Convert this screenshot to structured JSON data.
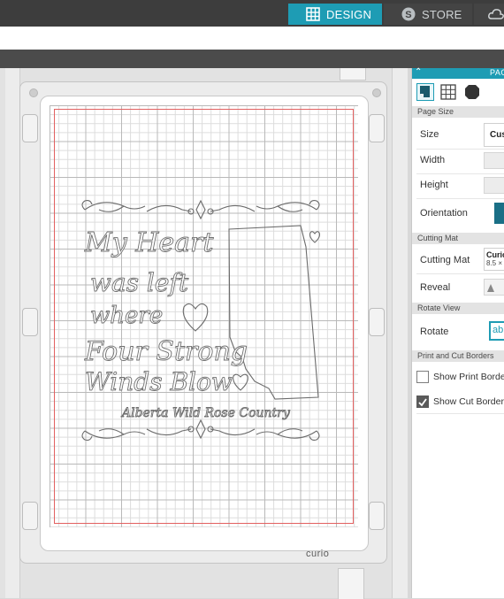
{
  "topbar": {
    "design_tab": "DESIGN",
    "store_tab": "STORE",
    "active_color": "#1e9cb4"
  },
  "workspace": {
    "brand": "curio",
    "design_text": {
      "line1": "My Heart",
      "line2": "was left",
      "line3": "where",
      "line4": "Four Strong",
      "line5": "Winds Blow",
      "subtitle": "Alberta Wild Rose Country"
    }
  },
  "panel": {
    "title": "PAG",
    "icons": [
      "page-setup-icon",
      "grid-icon",
      "cutting-mat-icon"
    ],
    "page_size_section": "Page Size",
    "size_label": "Size",
    "size_value": "Cus",
    "width_label": "Width",
    "height_label": "Height",
    "orientation_label": "Orientation",
    "cutting_mat_section": "Cutting Mat",
    "cutting_mat_label": "Cutting Mat",
    "cutting_mat_value": "Curio",
    "cutting_mat_size": "8.5 ×",
    "reveal_label": "Reveal",
    "rotate_view_section": "Rotate View",
    "rotate_label": "Rotate",
    "rotate_value": "ab",
    "borders_section": "Print and Cut Borders",
    "show_print_border": "Show Print Border",
    "show_print_border_checked": false,
    "show_cut_border": "Show Cut Border",
    "show_cut_border_checked": true
  }
}
